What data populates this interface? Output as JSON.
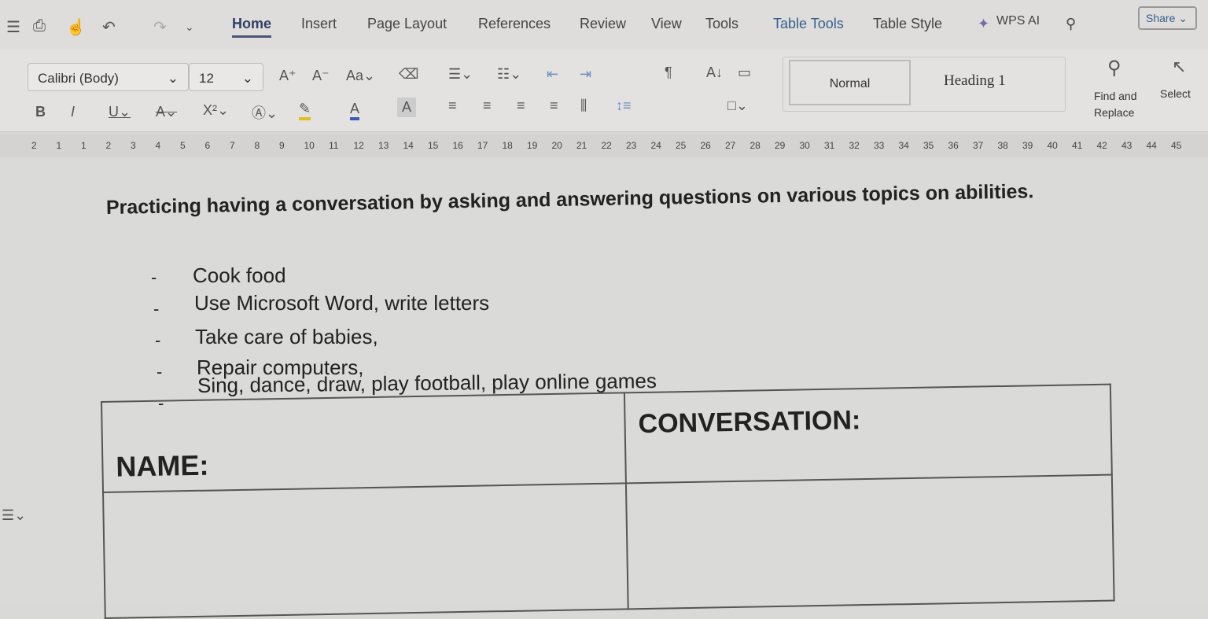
{
  "tabs": [
    "Home",
    "Insert",
    "Page Layout",
    "References",
    "Review",
    "View",
    "Tools",
    "Table Tools",
    "Table Style",
    "WPS AI"
  ],
  "share_label": "Share",
  "font": {
    "name": "Calibri (Body)",
    "size": "12"
  },
  "styles": {
    "normal": "Normal",
    "heading1": "Heading 1"
  },
  "find_replace": "Find and Replace",
  "select": "Select",
  "ruler": [
    "2",
    "1",
    "1",
    "2",
    "3",
    "4",
    "5",
    "6",
    "7",
    "8",
    "9",
    "10",
    "11",
    "12",
    "13",
    "14",
    "15",
    "16",
    "17",
    "18",
    "19",
    "20",
    "21",
    "22",
    "23",
    "24",
    "25",
    "26",
    "27",
    "28",
    "29",
    "30",
    "31",
    "32",
    "33",
    "34",
    "35",
    "36",
    "37",
    "38",
    "39",
    "40",
    "41",
    "42",
    "43",
    "44",
    "45"
  ],
  "document": {
    "title": "Practicing having a conversation by asking and answering questions on various topics on abilities.",
    "items": [
      "Cook food",
      "Use Microsoft Word, write letters",
      "Take care of babies,",
      "Repair computers,",
      "Sing, dance, draw, play football, play online games"
    ],
    "table": {
      "col1": "NAME:",
      "col2": "CONVERSATION:"
    }
  }
}
